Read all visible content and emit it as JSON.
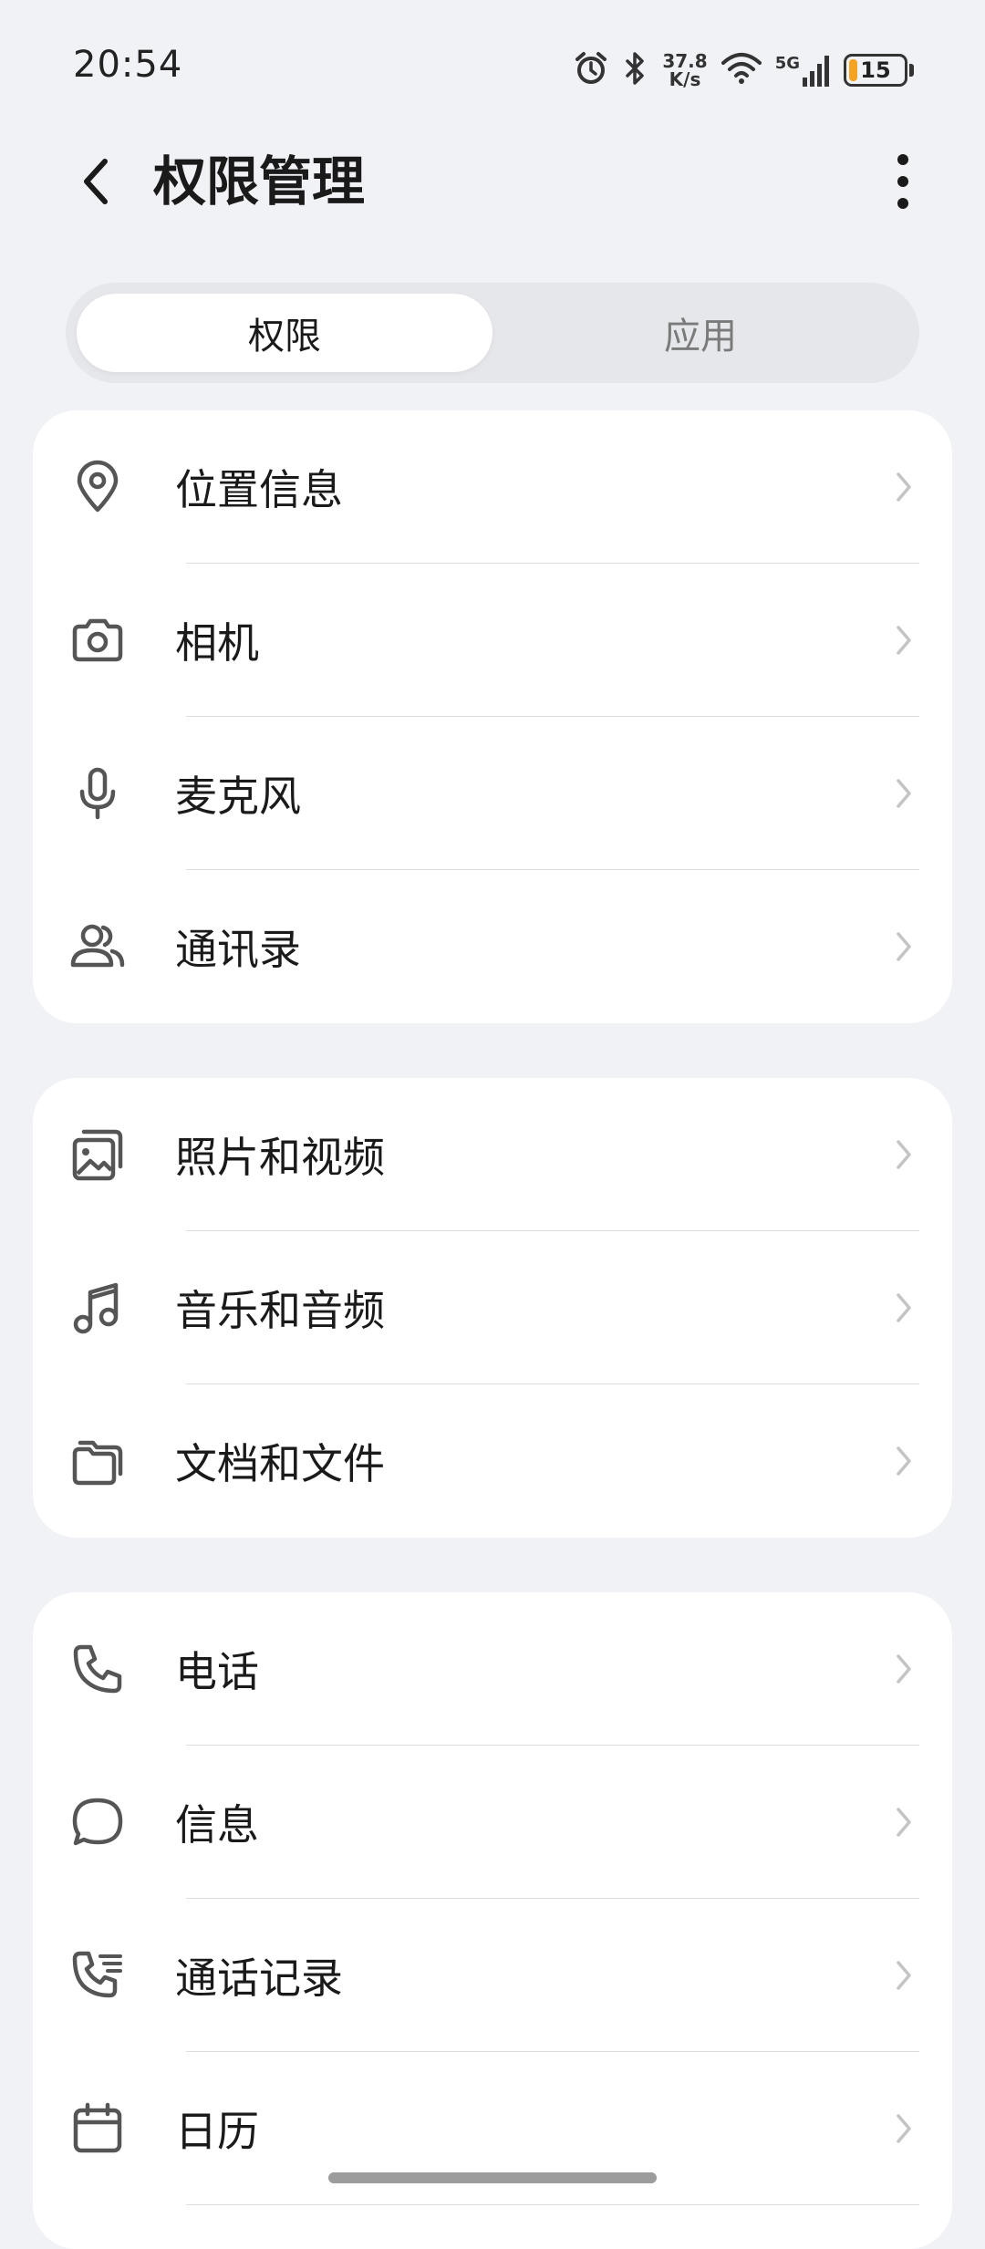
{
  "status_bar": {
    "time": "20:54",
    "net_speed_value": "37.8",
    "net_speed_unit": "K/s",
    "network_type": "5G",
    "battery_level": "15",
    "battery_fraction": 0.15,
    "battery_color": "#f4a422",
    "icons": [
      "alarm-icon",
      "bluetooth-icon",
      "wifi-icon",
      "signal-icon",
      "battery-icon"
    ]
  },
  "header": {
    "title": "权限管理",
    "back_icon": "back-arrow-icon",
    "more_icon": "more-vertical-icon"
  },
  "tabs": [
    {
      "label": "权限",
      "active": true
    },
    {
      "label": "应用",
      "active": false
    }
  ],
  "groups": [
    {
      "items": [
        {
          "label": "位置信息",
          "icon": "location-icon"
        },
        {
          "label": "相机",
          "icon": "camera-icon"
        },
        {
          "label": "麦克风",
          "icon": "microphone-icon"
        },
        {
          "label": "通讯录",
          "icon": "contacts-icon"
        }
      ]
    },
    {
      "items": [
        {
          "label": "照片和视频",
          "icon": "photos-icon"
        },
        {
          "label": "音乐和音频",
          "icon": "music-icon"
        },
        {
          "label": "文档和文件",
          "icon": "folder-icon"
        }
      ]
    },
    {
      "items": [
        {
          "label": "电话",
          "icon": "phone-icon"
        },
        {
          "label": "信息",
          "icon": "message-icon"
        },
        {
          "label": "通话记录",
          "icon": "call-log-icon"
        },
        {
          "label": "日历",
          "icon": "calendar-icon"
        }
      ]
    }
  ]
}
